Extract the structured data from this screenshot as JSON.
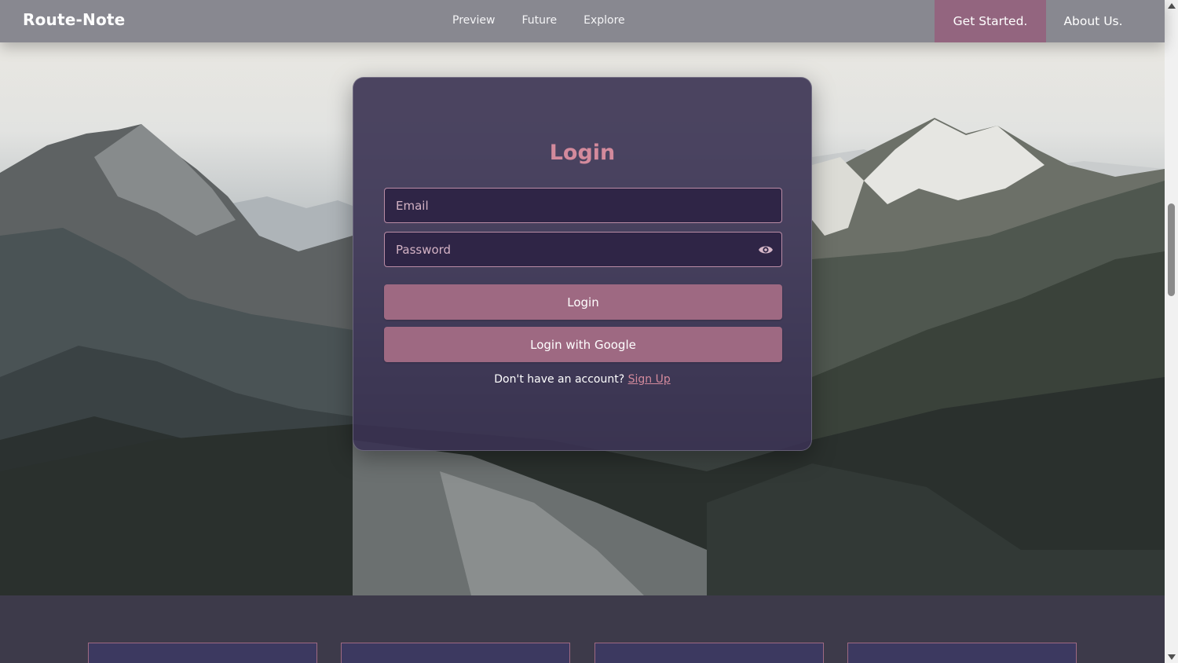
{
  "nav": {
    "brand": "Route-Note",
    "links": [
      "Preview",
      "Future",
      "Explore"
    ],
    "get_started": "Get Started.",
    "about": "About Us."
  },
  "login": {
    "title": "Login",
    "email_placeholder": "Email",
    "password_placeholder": "Password",
    "login_button": "Login",
    "google_button": "Login with Google",
    "signup_prompt": "Don't have an account?",
    "signup_link": "Sign Up"
  },
  "colors": {
    "accent": "#9e6982",
    "title": "#d38a9c",
    "card": "#3a3252",
    "nav": "#80808a"
  },
  "icons": {
    "password_toggle": "eye-icon"
  }
}
